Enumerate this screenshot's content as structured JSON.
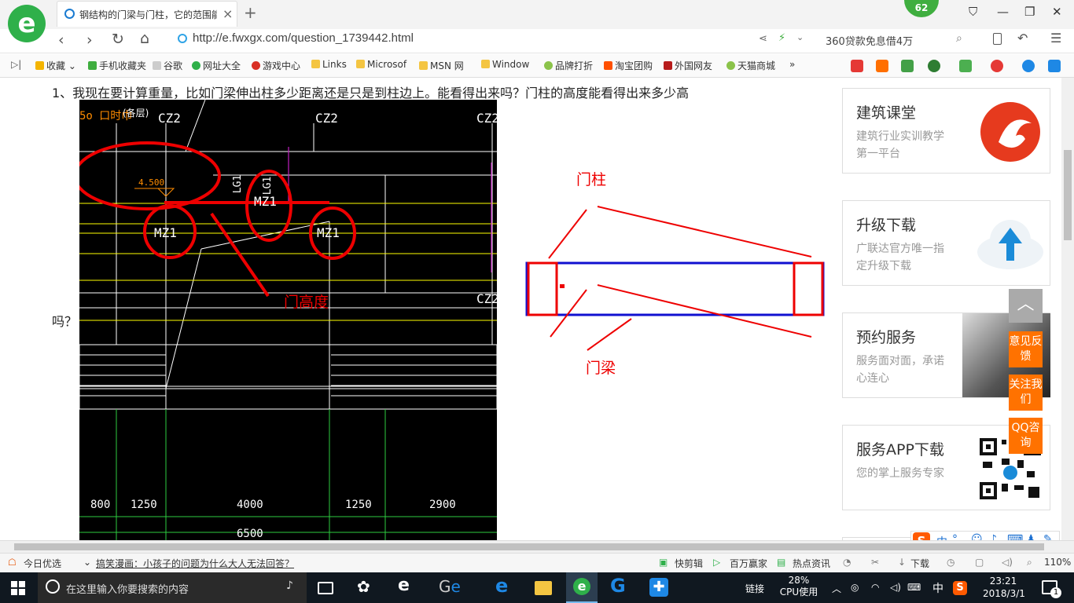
{
  "browser": {
    "tab_title": "钢结构的门梁与门柱，它的范围能",
    "url": "http://e.fwxgx.com/question_1739442.html",
    "search_text": "360贷款免息借4万",
    "badge_count": "62"
  },
  "bookmarks": [
    {
      "label": "收藏",
      "color": "#f4b400"
    },
    {
      "label": "手机收藏夹",
      "color": "#3fae3f"
    },
    {
      "label": "谷歌",
      "color": "#bbbbbb"
    },
    {
      "label": "网址大全",
      "color": "#2fb04a"
    },
    {
      "label": "游戏中心",
      "color": "#d93025"
    },
    {
      "label": "Links",
      "color": "#f4c542"
    },
    {
      "label": "Microsof",
      "color": "#f4c542"
    },
    {
      "label": "MSN 网",
      "color": "#f4c542"
    },
    {
      "label": "Window",
      "color": "#f4c542"
    },
    {
      "label": "品牌打折",
      "color": "#8bc34a"
    },
    {
      "label": "淘宝团购",
      "color": "#ff5000"
    },
    {
      "label": "外国网友",
      "color": "#b71c1c"
    },
    {
      "label": "天猫商城",
      "color": "#8bc34a"
    }
  ],
  "question": {
    "line1": "1、我现在要计算重量，比如门梁伸出柱多少距离还是只是到柱边上。能看得出来吗？门柱的高度能看得出来多少高",
    "line2": "吗？"
  },
  "cad": {
    "labels": [
      "CZ2",
      "CZ2",
      "CZ2",
      "CZ2",
      "LG1",
      "LG1",
      "MZ1",
      "MZ1",
      "MZ1",
      "4.500",
      "5o 口时巾",
      "(各层)"
    ],
    "annotation_height": "门高度",
    "dimensions": [
      "800",
      "1250",
      "4000",
      "1250",
      "2900",
      "6500"
    ]
  },
  "diagram": {
    "label_column": "门柱",
    "label_beam": "门梁"
  },
  "sidebar": [
    {
      "title": "建筑课堂",
      "subtitle": "建筑行业实训教学第一平台",
      "icon": "flame-logo-icon"
    },
    {
      "title": "升级下载",
      "subtitle": "广联达官方唯一指定升级下载",
      "icon": "cloud-upload-icon"
    },
    {
      "title": "预约服务",
      "subtitle": "服务面对面，承诺心连心",
      "icon": "handshake-photo-icon"
    },
    {
      "title": "服务APP下载",
      "subtitle": "您的掌上服务专家",
      "icon": "qr-code-icon"
    }
  ],
  "side_buttons": [
    "意见反馈",
    "关注我们",
    "QQ咨询"
  ],
  "ime_label": "中",
  "status_bar": {
    "today": "今日优选",
    "news": "搞笑漫画：小孩子的问题为什么大人无法回答？",
    "kuaijianji": "快剪辑",
    "baiwan": "百万赢家",
    "hot": "热点资讯",
    "download": "下载",
    "zoom": "110%"
  },
  "taskbar": {
    "search_placeholder": "在这里输入你要搜索的内容",
    "link": "链接",
    "cpu_pct": "28%",
    "cpu_label": "CPU使用",
    "ime": "中",
    "time": "23:21",
    "date": "2018/3/1",
    "notify_count": "1"
  }
}
